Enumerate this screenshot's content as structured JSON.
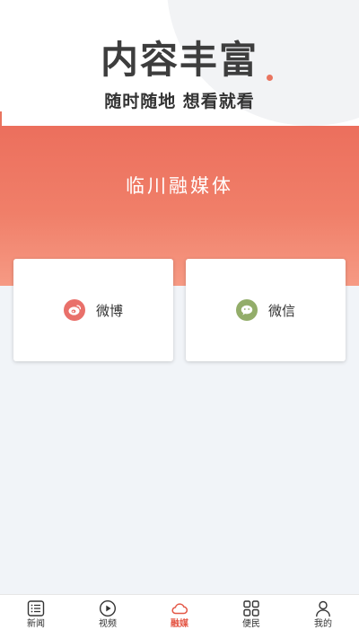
{
  "promo": {
    "headline": "内容丰富",
    "subheadline": "随时随地 想看就看"
  },
  "banner": {
    "title": "临川融媒体"
  },
  "cards": [
    {
      "label": "微博",
      "icon": "weibo-icon",
      "icon_color": "#e9706a"
    },
    {
      "label": "微信",
      "icon": "wechat-icon",
      "icon_color": "#93ad6a"
    }
  ],
  "tabbar": {
    "active_color": "#e45847",
    "items": [
      {
        "label": "新闻",
        "icon": "list-icon"
      },
      {
        "label": "视频",
        "icon": "play-icon"
      },
      {
        "label": "融媒",
        "icon": "cloud-icon",
        "active": true
      },
      {
        "label": "便民",
        "icon": "grid-icon"
      },
      {
        "label": "我的",
        "icon": "user-icon"
      }
    ]
  }
}
